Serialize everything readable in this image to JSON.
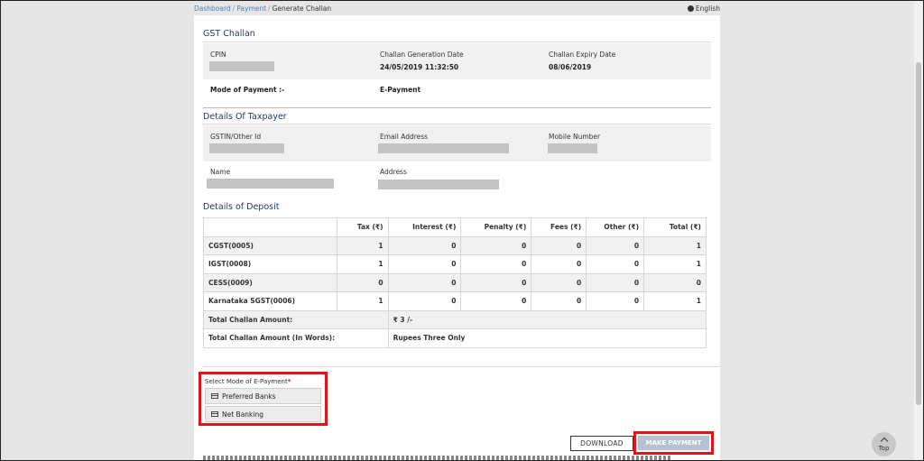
{
  "breadcrumb": {
    "items": [
      "Dashboard",
      "Payment"
    ],
    "current": "Generate Challan",
    "separator": "/"
  },
  "language": "English",
  "challan": {
    "title": "GST Challan",
    "cpin_label": "CPIN",
    "generation_label": "Challan Generation Date",
    "generation_value": "24/05/2019 11:32:50",
    "expiry_label": "Challan Expiry Date",
    "expiry_value": "08/06/2019",
    "mode_label": "Mode of Payment :-",
    "mode_value": "E-Payment"
  },
  "taxpayer": {
    "title": "Details Of Taxpayer",
    "gstin_label": "GSTIN/Other Id",
    "email_label": "Email Address",
    "mobile_label": "Mobile Number",
    "name_label": "Name",
    "address_label": "Address"
  },
  "deposit": {
    "title": "Details of Deposit",
    "headers": [
      "",
      "Tax (₹)",
      "Interest (₹)",
      "Penalty (₹)",
      "Fees (₹)",
      "Other (₹)",
      "Total (₹)"
    ],
    "rows": [
      {
        "name": "CGST(0005)",
        "values": [
          "1",
          "0",
          "0",
          "0",
          "0",
          "1"
        ]
      },
      {
        "name": "IGST(0008)",
        "values": [
          "1",
          "0",
          "0",
          "0",
          "0",
          "1"
        ]
      },
      {
        "name": "CESS(0009)",
        "values": [
          "0",
          "0",
          "0",
          "0",
          "0",
          "0"
        ]
      },
      {
        "name": "Karnataka SGST(0006)",
        "values": [
          "1",
          "0",
          "0",
          "0",
          "0",
          "1"
        ]
      }
    ],
    "total_label": "Total Challan Amount:",
    "total_value": "₹ 3 /-",
    "words_label": "Total Challan Amount (In Words):",
    "words_value": "Rupees Three Only"
  },
  "epayment": {
    "label": "Select Mode of E-Payment",
    "required_mark": "*",
    "options": [
      "Preferred Banks",
      "Net Banking"
    ]
  },
  "actions": {
    "download": "DOWNLOAD",
    "make_payment": "MAKE PAYMENT"
  },
  "scroll_top": "Top",
  "colors": {
    "accent": "#1e3d6b",
    "highlight": "#e0141b",
    "link": "#4a7fb5",
    "pay_button": "#b6c1d1"
  }
}
